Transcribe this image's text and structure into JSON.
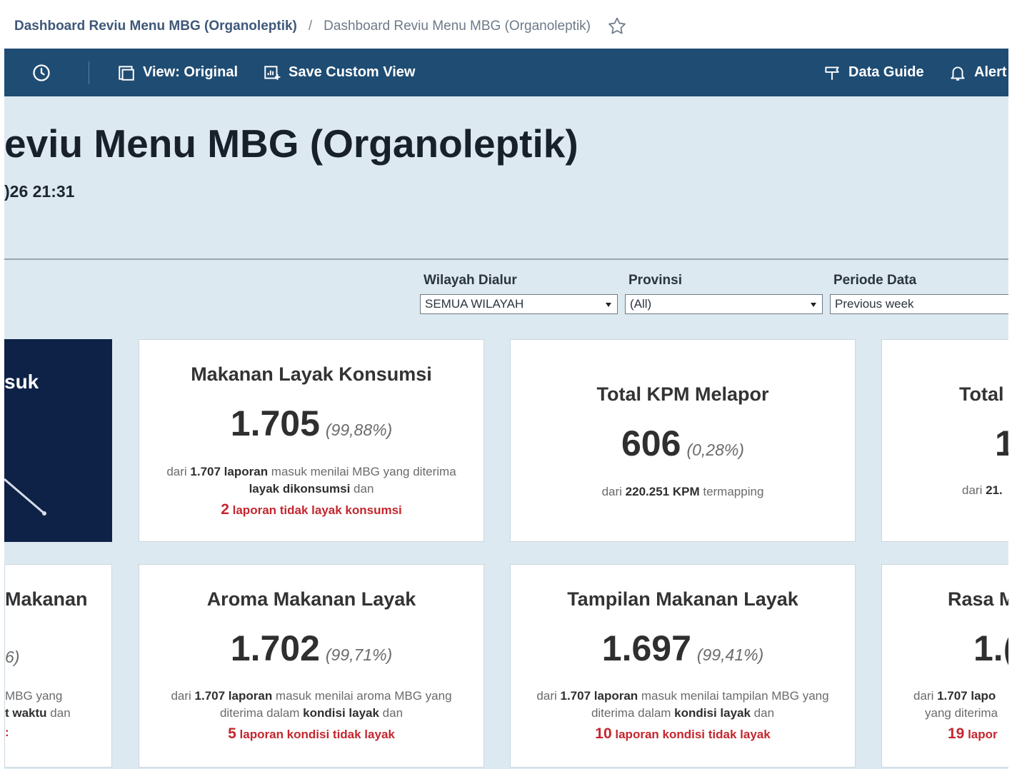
{
  "breadcrumb": {
    "item1": "Dashboard Reviu Menu MBG (Organoleptik)",
    "separator": "/",
    "item2": "Dashboard Reviu Menu MBG (Organoleptik)"
  },
  "toolbar": {
    "view_label": "View: Original",
    "save_label": "Save Custom View",
    "data_guide_label": "Data Guide",
    "alerts_label": "Alert"
  },
  "dashboard": {
    "title": "eviu Menu MBG (Organoleptik)",
    "updated": ")26 21:31"
  },
  "filters": {
    "wilayah": {
      "label": "Wilayah Dialur",
      "value": "SEMUA WILAYAH"
    },
    "provinsi": {
      "label": "Provinsi",
      "value": "(All)"
    },
    "periode": {
      "label": "Periode Data",
      "value": "Previous week"
    }
  },
  "cards": {
    "dark_partial": {
      "title": "suk"
    },
    "layak": {
      "title": "Makanan Layak Konsumsi",
      "value": "1.705",
      "percent": "(99,88%)",
      "d1": "dari ",
      "d2": "1.707 laporan",
      "d3": " masuk menilai MBG yang diterima ",
      "d4": "layak dikonsumsi",
      "d5": " dan",
      "alert_num": "2",
      "alert_text": " laporan tidak layak konsumsi"
    },
    "kpm": {
      "title": "Total KPM Melapor",
      "value": "606",
      "percent": "(0,28%)",
      "d1": "dari ",
      "d2": "220.251 KPM",
      "d3": " termapping"
    },
    "total_partial": {
      "title": "Total",
      "value": "1",
      "d1": "dari ",
      "d2": "21."
    },
    "left_partial": {
      "title": "Makanan",
      "percent": "6)",
      "line1": "MBG yang",
      "line2_b": "t waktu",
      "line2": " dan",
      "alert": ":"
    },
    "aroma": {
      "title": "Aroma Makanan Layak",
      "value": "1.702",
      "percent": "(99,71%)",
      "d1": "dari ",
      "d2": "1.707 laporan",
      "d3": " masuk menilai aroma MBG yang diterima dalam ",
      "d4": "kondisi layak",
      "d5": " dan",
      "alert_num": "5",
      "alert_text": " laporan kondisi tidak layak"
    },
    "tampilan": {
      "title": "Tampilan Makanan Layak",
      "value": "1.697",
      "percent": "(99,41%)",
      "d1": "dari ",
      "d2": "1.707 laporan",
      "d3": " masuk menilai tampilan MBG yang diterima dalam ",
      "d4": "kondisi layak",
      "d5": " dan",
      "alert_num": "10",
      "alert_text": " laporan kondisi tidak layak"
    },
    "rasa_partial": {
      "title": "Rasa M",
      "value": "1.(",
      "d1": "dari ",
      "d2": "1.707 lapo",
      "d3": "yang diterima",
      "alert_num": "19",
      "alert_text": " lapor"
    }
  },
  "colors": {
    "toolbar_bg": "#1f4c73",
    "content_bg": "#dce9f0",
    "dark_card": "#0e2247",
    "alert_red": "#c4262e"
  }
}
